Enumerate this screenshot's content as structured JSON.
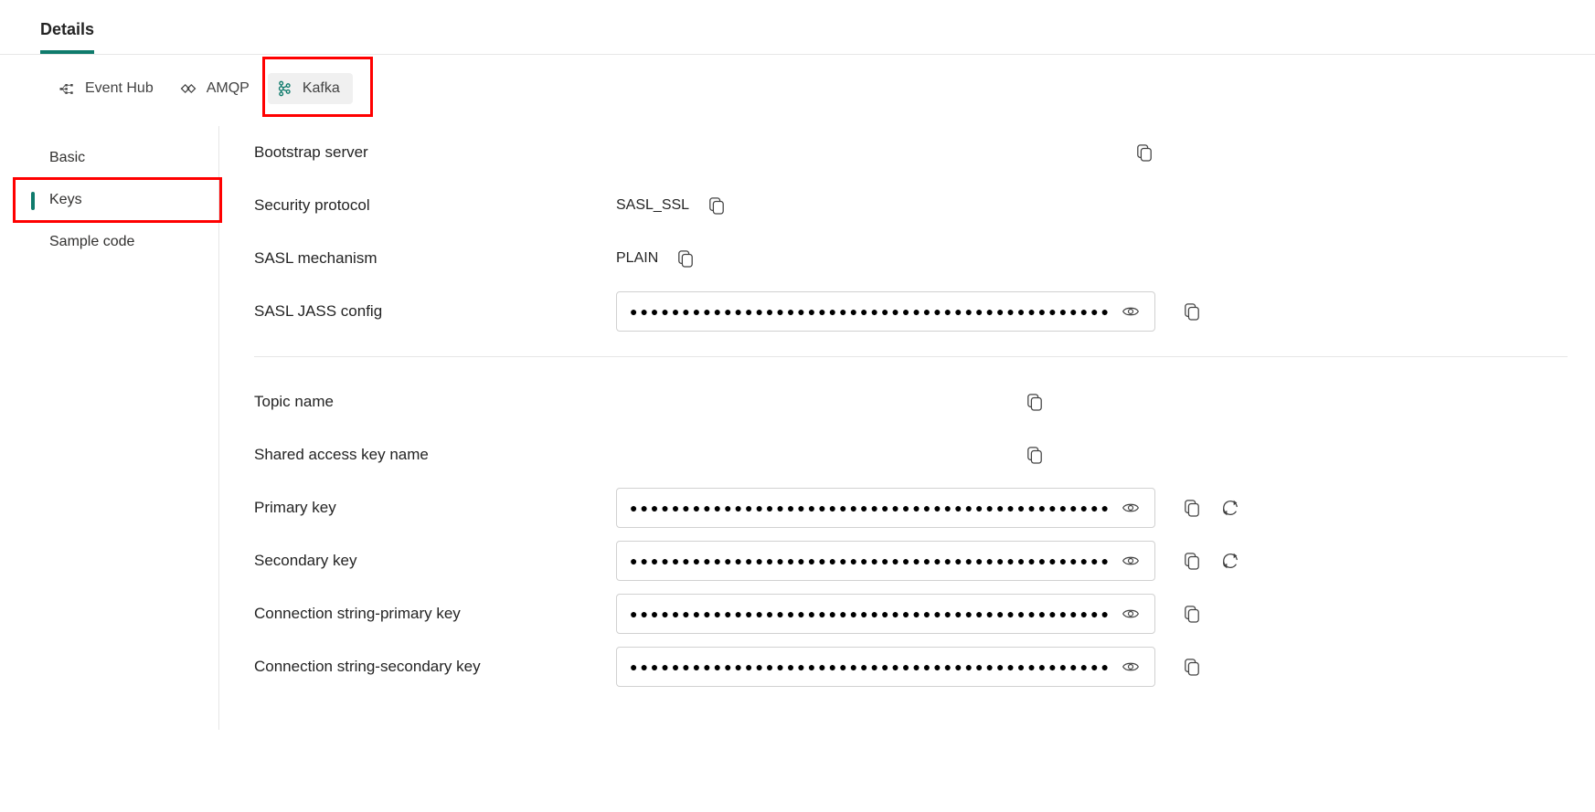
{
  "top_tab": "Details",
  "protocol_tabs": [
    {
      "label": "Event Hub"
    },
    {
      "label": "AMQP"
    },
    {
      "label": "Kafka"
    }
  ],
  "side_nav": [
    {
      "label": "Basic"
    },
    {
      "label": "Keys"
    },
    {
      "label": "Sample code"
    }
  ],
  "fields": {
    "bootstrap_server": {
      "label": "Bootstrap server",
      "value": ""
    },
    "security_protocol": {
      "label": "Security protocol",
      "value": "SASL_SSL"
    },
    "sasl_mechanism": {
      "label": "SASL mechanism",
      "value": "PLAIN"
    },
    "sasl_jass": {
      "label": "SASL JASS config"
    },
    "topic_name": {
      "label": "Topic name",
      "value": ""
    },
    "shared_access_key_name": {
      "label": "Shared access key name",
      "value": ""
    },
    "primary_key": {
      "label": "Primary key"
    },
    "secondary_key": {
      "label": "Secondary key"
    },
    "conn_primary": {
      "label": "Connection string-primary key"
    },
    "conn_secondary": {
      "label": "Connection string-secondary key"
    }
  },
  "masked": "●●●●●●●●●●●●●●●●●●●●●●●●●●●●●●●●●●●●●●●●●●●●●●●●●●●●●●●●●●●●●●●●●●●●●"
}
